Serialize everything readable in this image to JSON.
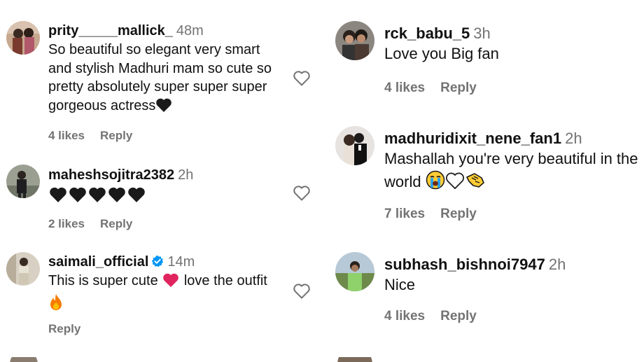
{
  "left_comments": [
    {
      "username": "prity_____mallick_",
      "time": "48m",
      "text": "So beautiful so elegant very smart and stylish Madhuri mam so cute so pretty absolutely super super super gorgeous actress",
      "likes": "4 likes",
      "reply": "Reply",
      "emoji": [
        "black-heart"
      ]
    },
    {
      "username": "maheshsojitra2382",
      "time": "2h",
      "text": "",
      "likes": "2 likes",
      "reply": "Reply",
      "emoji": [
        "black-heart",
        "black-heart",
        "black-heart",
        "black-heart",
        "black-heart"
      ]
    },
    {
      "username": "saimali_official",
      "verified": true,
      "time": "14m",
      "text_before": "This is super cute",
      "text_after": "love the outfit",
      "reply": "Reply",
      "emoji": [
        "red-heart",
        "fire"
      ]
    }
  ],
  "right_comments": [
    {
      "username": "rck_babu_5",
      "time": "3h",
      "text": "Love you Big fan",
      "likes": "4 likes",
      "reply": "Reply"
    },
    {
      "username": "madhuridixit_nene_fan1",
      "time": "2h",
      "text": "Mashallah you're very beautiful in the world",
      "likes": "7 likes",
      "reply": "Reply",
      "emoji": [
        "loudly-crying-face",
        "white-heart",
        "pinched-fingers"
      ]
    },
    {
      "username": "subhash_bishnoi7947",
      "time": "2h",
      "text": "Nice",
      "likes": "4 likes",
      "reply": "Reply"
    }
  ],
  "colors": {
    "username": "#111111",
    "muted": "#737373",
    "verified": "#0095f6",
    "red_heart": "#e0245e"
  }
}
